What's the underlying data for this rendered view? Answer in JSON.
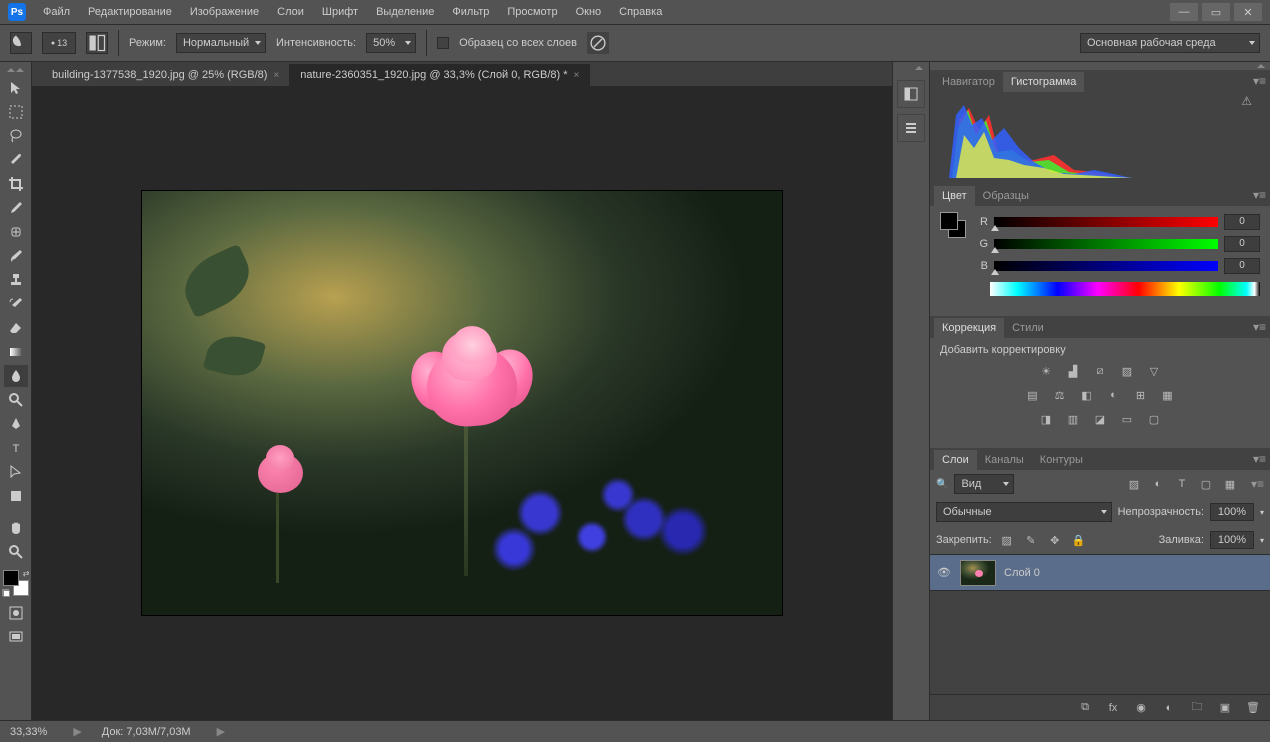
{
  "menu": [
    "Файл",
    "Редактирование",
    "Изображение",
    "Слои",
    "Шрифт",
    "Выделение",
    "Фильтр",
    "Просмотр",
    "Окно",
    "Справка"
  ],
  "options": {
    "brush_size": "13",
    "mode_label": "Режим:",
    "mode_value": "Нормальный",
    "intensity_label": "Интенсивность:",
    "intensity_value": "50%",
    "sample_all": "Образец со всех слоев",
    "workspace": "Основная рабочая среда"
  },
  "tabs": [
    {
      "label": "building-1377538_1920.jpg @ 25% (RGB/8)",
      "active": false
    },
    {
      "label": "nature-2360351_1920.jpg @ 33,3% (Слой 0, RGB/8) *",
      "active": true
    }
  ],
  "panels": {
    "nav_hist": {
      "tabs": [
        "Навигатор",
        "Гистограмма"
      ],
      "activeIndex": 1,
      "warning": "⚠"
    },
    "color": {
      "tabs": [
        "Цвет",
        "Образцы"
      ],
      "activeIndex": 0,
      "channels": [
        {
          "l": "R",
          "v": "0"
        },
        {
          "l": "G",
          "v": "0"
        },
        {
          "l": "B",
          "v": "0"
        }
      ]
    },
    "adjust": {
      "tabs": [
        "Коррекция",
        "Стили"
      ],
      "activeIndex": 0,
      "title": "Добавить корректировку"
    },
    "layers": {
      "tabs": [
        "Слои",
        "Каналы",
        "Контуры"
      ],
      "activeIndex": 0,
      "filter": "Вид",
      "blend": "Обычные",
      "opacity_label": "Непрозрачность:",
      "opacity": "100%",
      "lock_label": "Закрепить:",
      "fill_label": "Заливка:",
      "fill": "100%",
      "layer_name": "Слой 0"
    }
  },
  "status": {
    "zoom": "33,33%",
    "doc": "Док: 7,03M/7,03M"
  }
}
